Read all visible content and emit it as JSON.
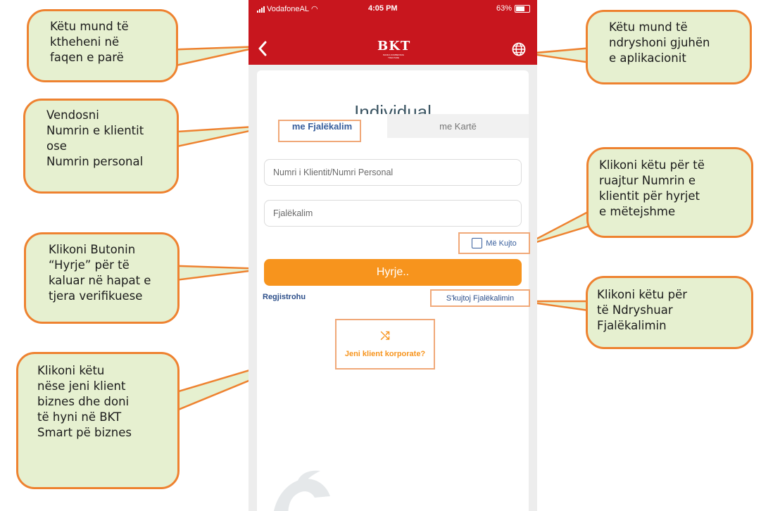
{
  "status_bar": {
    "carrier": "VodafoneAL",
    "time": "4:05 PM",
    "battery": "63%"
  },
  "header": {
    "logo_text": "BKT",
    "logo_subtitle": "BANKA KOMBETARE TREGTARE",
    "back_icon": "chevron-left-icon",
    "language_icon": "globe-icon",
    "bar_color": "#c8161e"
  },
  "login": {
    "title": "Individual",
    "tabs": [
      {
        "label": "me Fjalëkalim",
        "active": true
      },
      {
        "label": "me Kartë",
        "active": false
      }
    ],
    "client_number_placeholder": "Numri i Klientit/Numri Personal",
    "password_placeholder": "Fjalëkalim",
    "remember_label": "Më Kujto",
    "login_button": "Hyrje..",
    "register_link": "Regjistrohu",
    "forgot_password_link": "S'kujtoj Fjalëkalimin",
    "corporate_label": "Jeni klient korporate?",
    "corporate_icon": "shuffle-icon",
    "accent_color": "#f7941d"
  },
  "callouts": {
    "back": "Këtu mund të\nktheheni në\nfaqen e parë",
    "language": "Këtu mund të\nndryshoni gjuhën\ne aplikacionit",
    "client_number": "Vendosni\nNumrin e klientit\nose\nNumrin personal",
    "remember": "Klikoni këtu për të\nruajtur Numrin e\nklientit për hyrjet\ne mëtejshme",
    "login": "Klikoni Butonin\n“Hyrje” për të\nkaluar në hapat e\ntjera verifikuese",
    "forgot_password": "Klikoni këtu për\ntë Ndryshuar\nFjalëkalimin",
    "corporate": "Klikoni këtu\nnëse jeni klient\nbiznes dhe doni\ntë hyni në BKT\nSmart pë biznes",
    "border_color": "#ee8230",
    "fill_color": "#e6f0d0"
  }
}
